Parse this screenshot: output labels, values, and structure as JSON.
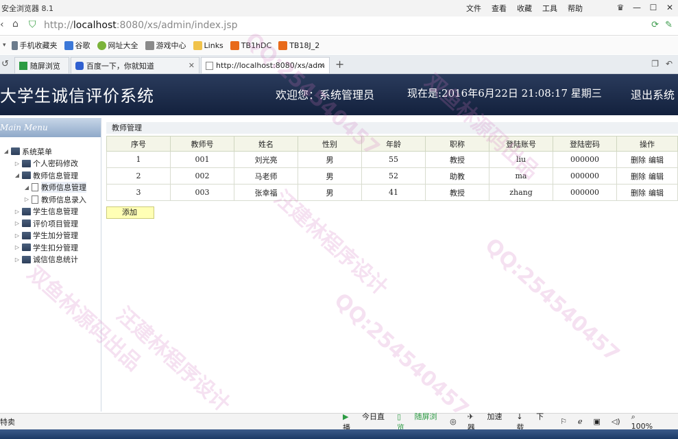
{
  "browser": {
    "title": "安全浏览器 8.1",
    "menus": [
      "文件",
      "查看",
      "收藏",
      "工具",
      "帮助"
    ],
    "url_prefix": "http://",
    "url_host": "localhost",
    "url_rest": ":8080/xs/admin/index.jsp",
    "favorites": [
      "手机收藏夹",
      "谷歌",
      "网址大全",
      "游戏中心",
      "Links",
      "TB1hDC",
      "TB18J_2"
    ],
    "tabs": [
      {
        "label": "随屏浏览"
      },
      {
        "label": "百度一下，你就知道"
      },
      {
        "label": "http://localhost:8080/xs/adm"
      }
    ],
    "new_tab": "+"
  },
  "app": {
    "system_name": "大学生诚信评价系统",
    "welcome": "欢迎您：系统管理员",
    "now": "现在是:2016年6月22日 21:08:17 星期三",
    "logout": "退出系统"
  },
  "sidebar": {
    "header": "Main Menu",
    "tree": [
      {
        "label": "系统菜单",
        "level": 0,
        "toggle": "◢",
        "type": "folder"
      },
      {
        "label": "个人密码修改",
        "level": 1,
        "toggle": "▷",
        "type": "folder"
      },
      {
        "label": "教师信息管理",
        "level": 1,
        "toggle": "◢",
        "type": "folder"
      },
      {
        "label": "教师信息管理",
        "level": 2,
        "toggle": "◢",
        "type": "doc"
      },
      {
        "label": "教师信息录入",
        "level": 2,
        "toggle": "▷",
        "type": "doc"
      },
      {
        "label": "学生信息管理",
        "level": 1,
        "toggle": "▷",
        "type": "folder"
      },
      {
        "label": "评价项目管理",
        "level": 1,
        "toggle": "▷",
        "type": "folder"
      },
      {
        "label": "学生加分管理",
        "level": 1,
        "toggle": "▷",
        "type": "folder"
      },
      {
        "label": "学生扣分管理",
        "level": 1,
        "toggle": "▷",
        "type": "folder"
      },
      {
        "label": "诚信信息统计",
        "level": 1,
        "toggle": "▷",
        "type": "folder"
      }
    ]
  },
  "main": {
    "breadcrumb": "教师管理",
    "columns": [
      "序号",
      "教师号",
      "姓名",
      "性别",
      "年龄",
      "职称",
      "登陆账号",
      "登陆密码",
      "操作"
    ],
    "rows": [
      {
        "no": "1",
        "tid": "001",
        "name": "刘光亮",
        "sex": "男",
        "age": "55",
        "title": "教授",
        "account": "liu",
        "password": "000000"
      },
      {
        "no": "2",
        "tid": "002",
        "name": "马老师",
        "sex": "男",
        "age": "52",
        "title": "助教",
        "account": "ma",
        "password": "000000"
      },
      {
        "no": "3",
        "tid": "003",
        "name": "张幸福",
        "sex": "男",
        "age": "41",
        "title": "教授",
        "account": "zhang",
        "password": "000000"
      }
    ],
    "delete_label": "删除",
    "edit_label": "编辑",
    "add_label": "添加"
  },
  "status": {
    "left": "特卖",
    "items": [
      "今日直播",
      "随屏浏览",
      "加速器",
      "下载",
      "100%"
    ]
  },
  "watermarks": [
    "QQ:254540457",
    "双鱼林源码出品",
    "汪建林程序设计"
  ]
}
